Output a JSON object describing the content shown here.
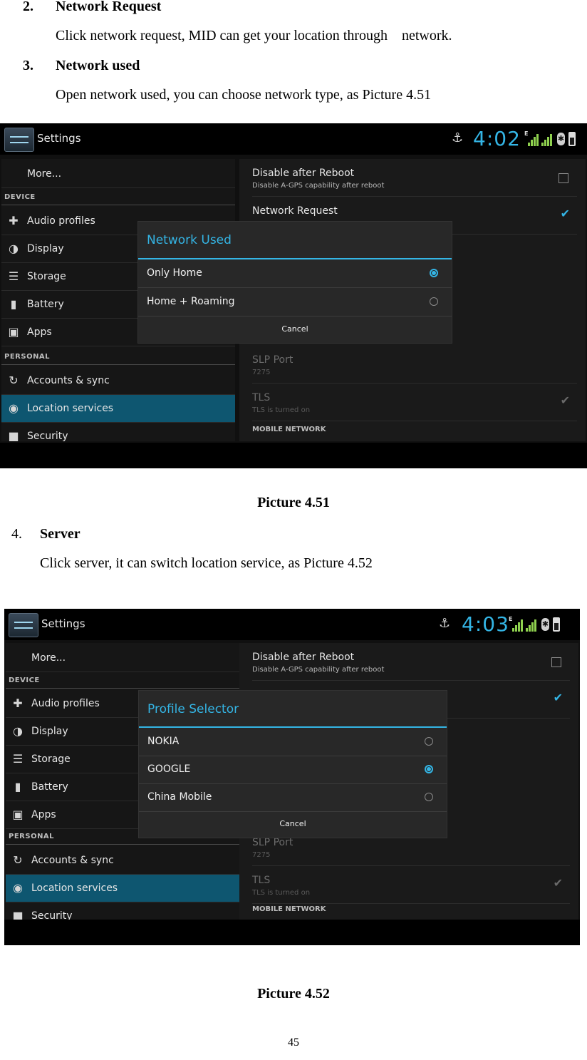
{
  "document": {
    "section2": {
      "number": "2.",
      "title": "Network Request",
      "body": "Click network request, MID can get your location through    network."
    },
    "section3": {
      "number": "3.",
      "title": "Network used",
      "body": "Open network used, you can choose network type, as Picture 4.51"
    },
    "caption1": "Picture 4.51",
    "section4": {
      "number": "4.",
      "title": "Server",
      "body": "Click server, it can switch location service, as Picture 4.52"
    },
    "caption2": "Picture 4.52",
    "page_number": "45"
  },
  "screens": [
    {
      "app_title": "Settings",
      "time": "4:02",
      "network_letter": "E",
      "sidebar": {
        "more": "More...",
        "device_header": "DEVICE",
        "items": [
          "Audio profiles",
          "Display",
          "Storage",
          "Battery",
          "Apps"
        ],
        "personal_header": "PERSONAL",
        "personal_items": [
          "Accounts & sync",
          "Location services",
          "Security"
        ]
      },
      "settings": {
        "disable_title": "Disable after Reboot",
        "disable_sub": "Disable A-GPS capability after reboot",
        "network_request": "Network Request",
        "slp_title": "SLP Port",
        "slp_value": "7275",
        "tls_title": "TLS",
        "tls_sub": "TLS is turned on",
        "mobile_header": "MOBILE NETWORK"
      },
      "dialog": {
        "title": "Network Used",
        "options": [
          "Only Home",
          "Home + Roaming"
        ],
        "cancel": "Cancel"
      }
    },
    {
      "app_title": "Settings",
      "time": "4:03",
      "network_letter": "E",
      "sidebar": {
        "more": "More...",
        "device_header": "DEVICE",
        "items": [
          "Audio profiles",
          "Display",
          "Storage",
          "Battery",
          "Apps"
        ],
        "personal_header": "PERSONAL",
        "personal_items": [
          "Accounts & sync",
          "Location services",
          "Security"
        ]
      },
      "settings": {
        "disable_title": "Disable after Reboot",
        "disable_sub": "Disable A-GPS capability after reboot",
        "slp_title": "SLP Port",
        "slp_value": "7275",
        "tls_title": "TLS",
        "tls_sub": "TLS is turned on",
        "mobile_header": "MOBILE NETWORK"
      },
      "dialog": {
        "title": "Profile Selector",
        "options": [
          "NOKIA",
          "GOOGLE",
          "China Mobile"
        ],
        "cancel": "Cancel"
      }
    }
  ],
  "colors": {
    "accent": "#34b5e5",
    "selected_row": "#0e5670",
    "signal": "#8fd14f"
  }
}
